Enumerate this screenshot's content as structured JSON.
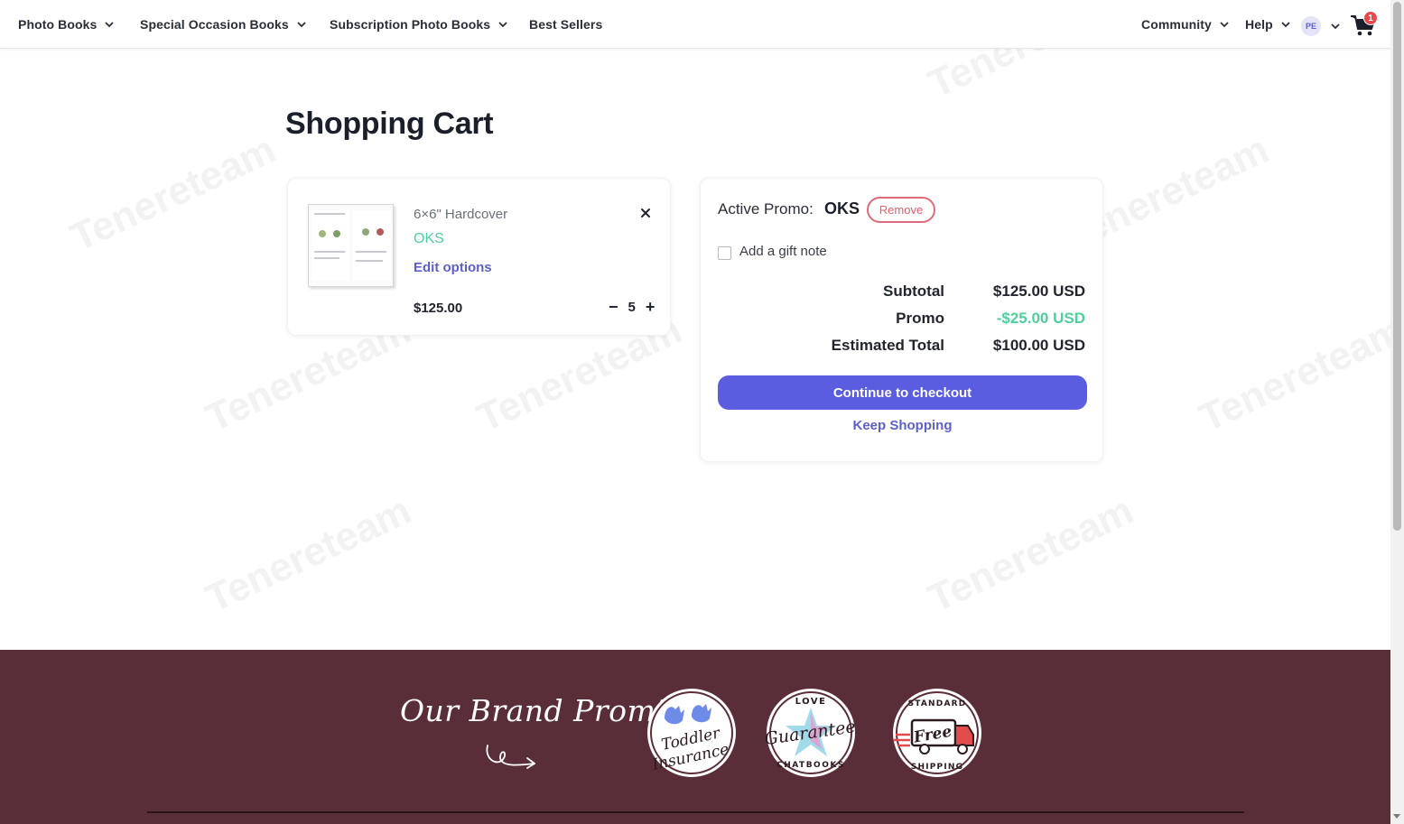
{
  "nav": {
    "left_items": [
      {
        "label": "Photo Books"
      },
      {
        "label": "Special Occasion Books"
      },
      {
        "label": "Subscription Photo Books"
      },
      {
        "label": "Best Sellers"
      }
    ],
    "right_items": [
      {
        "label": "Community"
      },
      {
        "label": "Help"
      }
    ],
    "avatar_initials": "PE",
    "cart_count": "1"
  },
  "page": {
    "title": "Shopping Cart"
  },
  "cart_item": {
    "name": "6×6\" Hardcover",
    "promo": "OKS",
    "edit_label": "Edit options",
    "price": "$125.00",
    "quantity": "5",
    "minus": "−",
    "plus": "+"
  },
  "summary": {
    "promo_label": "Active Promo:",
    "promo_code": "OKS",
    "remove_label": "Remove",
    "gift_note_label": "Add a gift note",
    "gift_note_checked": false,
    "rows": [
      {
        "label": "Subtotal",
        "value": "$125.00 USD"
      },
      {
        "label": "Promo",
        "value": "-$25.00 USD"
      },
      {
        "label": "Estimated Total",
        "value": "$100.00 USD"
      }
    ],
    "checkout_label": "Continue to checkout",
    "keep_shopping_label": "Keep Shopping"
  },
  "footer": {
    "brand_title": "Our Brand Promises",
    "badges": [
      {
        "icon": "toddler-insurance-badge-icon",
        "top": "Toddler",
        "bottom": "Insurance"
      },
      {
        "icon": "love-guarantee-badge-icon",
        "top": "LOVE",
        "middle": "Guarantee",
        "bottom": "CHATBOOKS"
      },
      {
        "icon": "free-shipping-badge-icon",
        "top": "STANDARD",
        "middle": "Free",
        "bottom": "SHIPPING"
      }
    ]
  },
  "watermark": "Tenereteam",
  "colors": {
    "accent": "#5b5de0",
    "link": "#5d60c9",
    "promo_green": "#4fcf9c",
    "remove_red": "#e0606e",
    "footer_bg": "#5a2e38",
    "badge": "#e5484d"
  }
}
